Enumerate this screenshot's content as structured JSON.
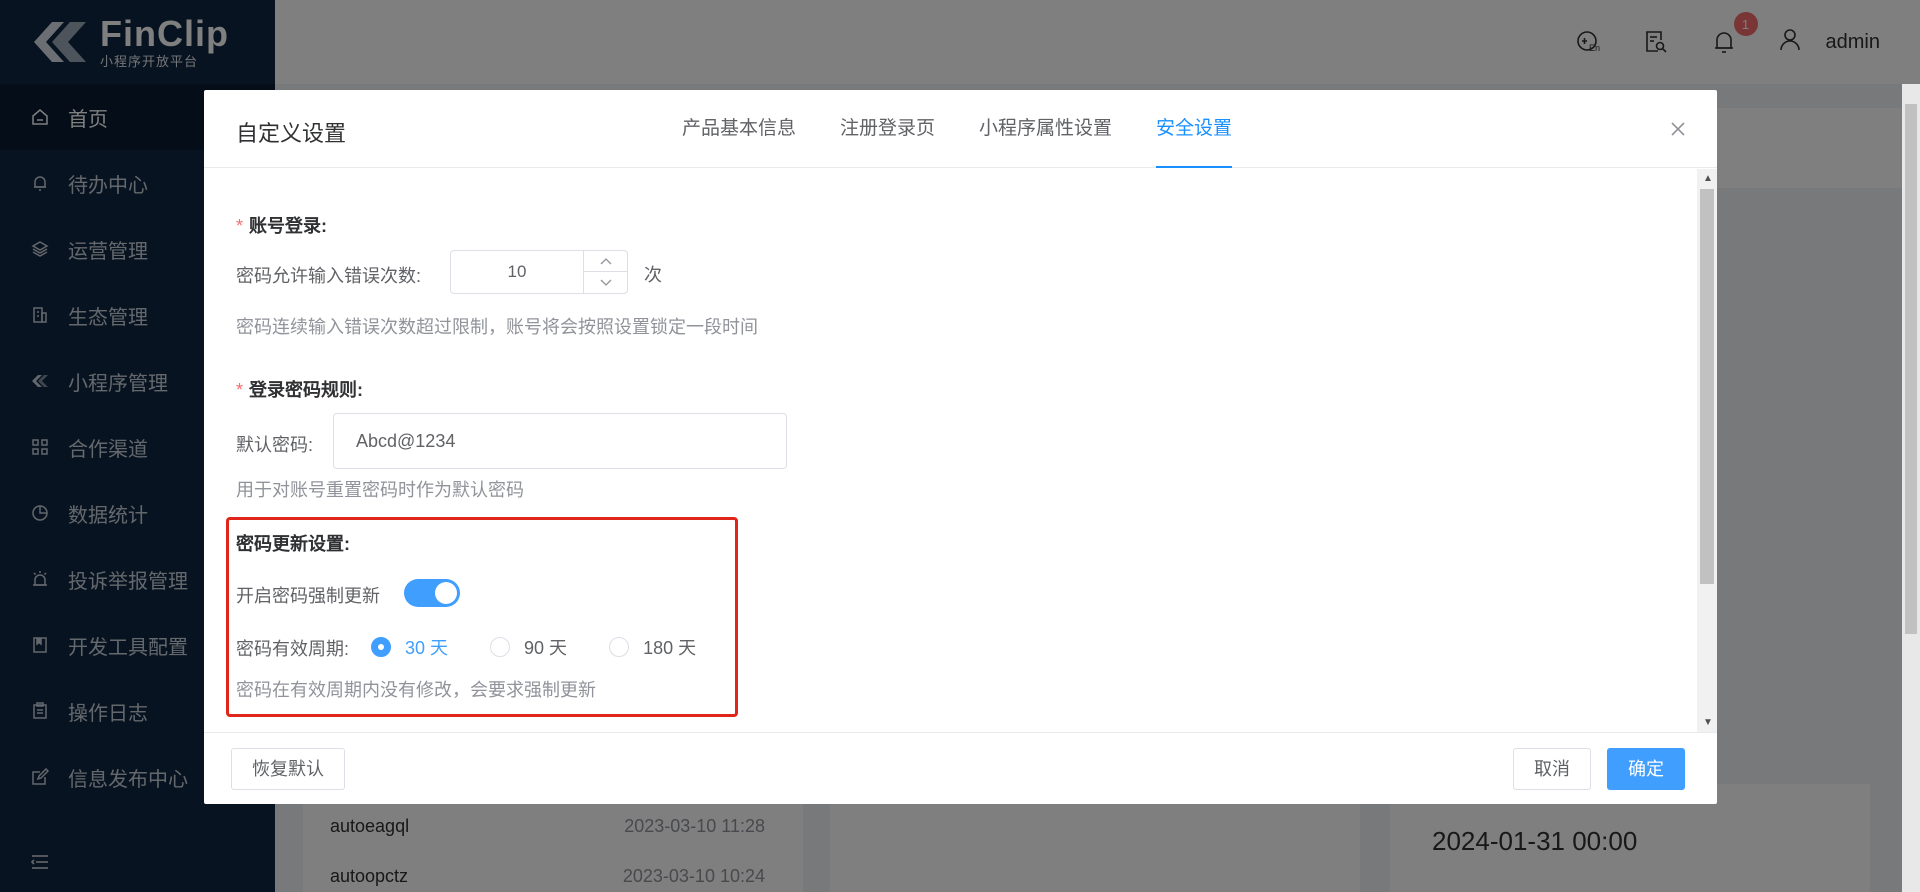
{
  "app": {
    "logo_title": "FinClip",
    "logo_subtitle": "小程序开放平台"
  },
  "sidebar": {
    "items": [
      {
        "label": "首页",
        "icon": "home-icon",
        "active": true
      },
      {
        "label": "待办中心",
        "icon": "bell-icon"
      },
      {
        "label": "运营管理",
        "icon": "layers-icon"
      },
      {
        "label": "生态管理",
        "icon": "building-icon"
      },
      {
        "label": "小程序管理",
        "icon": "miniapp-icon"
      },
      {
        "label": "合作渠道",
        "icon": "grid-icon"
      },
      {
        "label": "数据统计",
        "icon": "pie-chart-icon"
      },
      {
        "label": "投诉举报管理",
        "icon": "alarm-icon"
      },
      {
        "label": "开发工具配置",
        "icon": "book-icon"
      },
      {
        "label": "操作日志",
        "icon": "clipboard-icon"
      },
      {
        "label": "信息发布中心",
        "icon": "edit-icon"
      }
    ]
  },
  "header": {
    "notification_count": "1",
    "username": "admin"
  },
  "background": {
    "rows": [
      {
        "name": "autoeagql",
        "time": "2023-03-10 11:28"
      },
      {
        "name": "autoopctz",
        "time": "2023-03-10 10:24"
      }
    ],
    "date_value": "2024-01-31 00:00"
  },
  "modal": {
    "title": "自定义设置",
    "tabs": [
      {
        "label": "产品基本信息"
      },
      {
        "label": "注册登录页"
      },
      {
        "label": "小程序属性设置"
      },
      {
        "label": "安全设置",
        "active": true
      }
    ],
    "account_login": {
      "title": "账号登录:",
      "max_errors_label": "密码允许输入错误次数:",
      "max_errors_value": "10",
      "max_errors_unit": "次",
      "hint": "密码连续输入错误次数超过限制，账号将会按照设置锁定一段时间"
    },
    "password_rules": {
      "title": "登录密码规则:",
      "default_label": "默认密码:",
      "default_value": "Abcd@1234",
      "hint": "用于对账号重置密码时作为默认密码"
    },
    "password_update": {
      "title": "密码更新设置:",
      "force_label": "开启密码强制更新",
      "force_enabled": true,
      "period_label": "密码有效周期:",
      "options": [
        "30 天",
        "90 天",
        "180 天"
      ],
      "selected": "30 天",
      "hint": "密码在有效周期内没有修改，会要求强制更新"
    },
    "footer": {
      "reset_label": "恢复默认",
      "cancel_label": "取消",
      "confirm_label": "确定"
    }
  },
  "colors": {
    "sidebar_bg": "#0f2741",
    "primary": "#409eff",
    "tab_active": "#1890ff",
    "highlight_border": "#e0251b",
    "required": "#f56c6c"
  }
}
